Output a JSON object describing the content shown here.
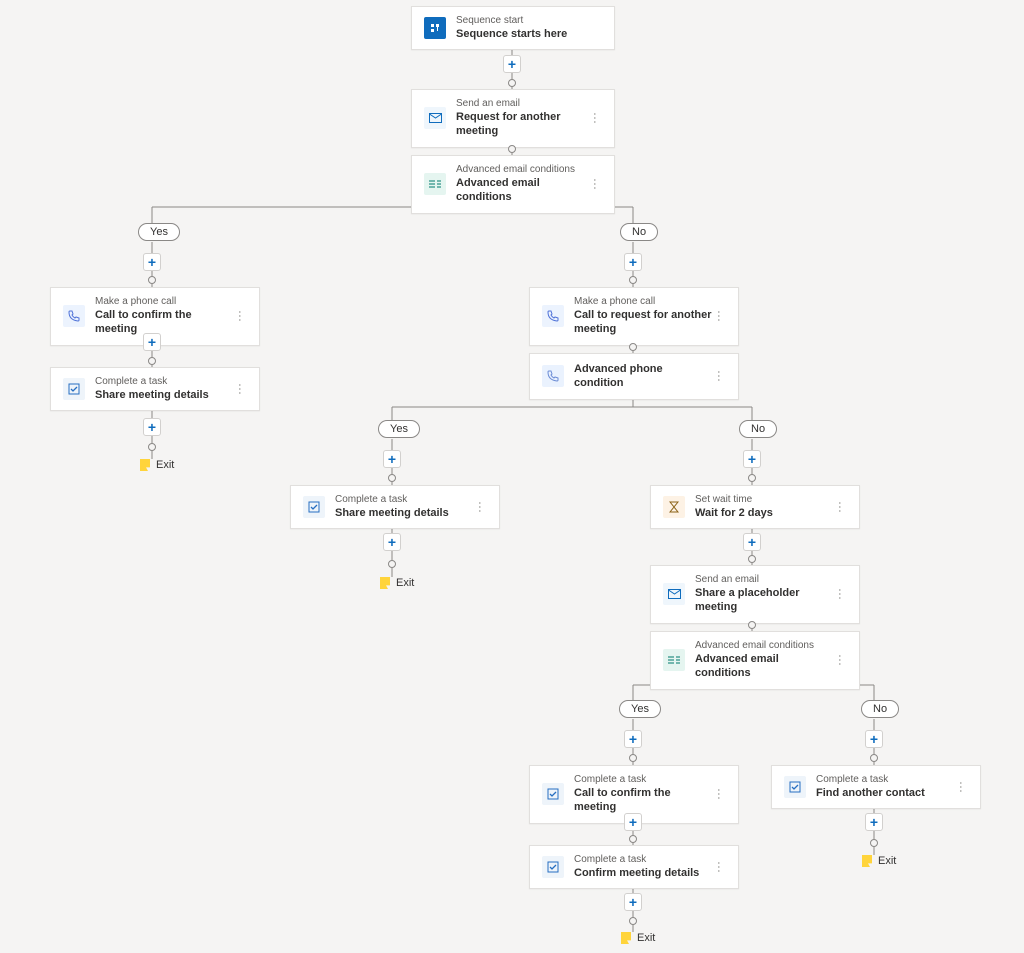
{
  "labels": {
    "yes": "Yes",
    "no": "No",
    "exit": "Exit"
  },
  "nodes": {
    "start": {
      "subtitle": "Sequence start",
      "title": "Sequence starts here"
    },
    "email1": {
      "subtitle": "Send an email",
      "title": "Request for another meeting"
    },
    "cond1": {
      "subtitle": "Advanced email conditions",
      "title": "Advanced email conditions"
    },
    "call_yes1": {
      "subtitle": "Make a phone call",
      "title": "Call to confirm the meeting"
    },
    "task_yes1": {
      "subtitle": "Complete a task",
      "title": "Share meeting details"
    },
    "call_no1": {
      "subtitle": "Make a phone call",
      "title": "Call to request for another meeting"
    },
    "phonecond": {
      "subtitle": "",
      "title": "Advanced phone condition"
    },
    "task_pc_y": {
      "subtitle": "Complete a task",
      "title": "Share meeting details"
    },
    "wait": {
      "subtitle": "Set wait time",
      "title": "Wait for 2 days"
    },
    "email2": {
      "subtitle": "Send an email",
      "title": "Share a placeholder meeting"
    },
    "cond2": {
      "subtitle": "Advanced email conditions",
      "title": "Advanced email conditions"
    },
    "task_c2_y1": {
      "subtitle": "Complete a task",
      "title": "Call to confirm the meeting"
    },
    "task_c2_y2": {
      "subtitle": "Complete a task",
      "title": "Confirm meeting details"
    },
    "task_c2_n": {
      "subtitle": "Complete a task",
      "title": "Find another contact"
    }
  }
}
